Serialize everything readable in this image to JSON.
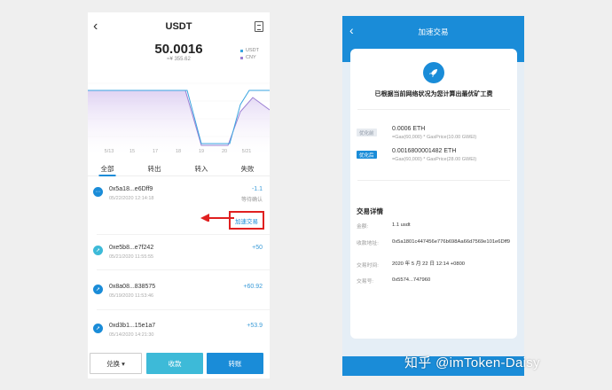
{
  "left": {
    "title": "USDT",
    "balance": "50.0016",
    "fiat": "≈¥ 355.62",
    "legend": [
      {
        "label": "USDT",
        "color": "#3aa5e0"
      },
      {
        "label": "CNY",
        "color": "#9b7fd3"
      }
    ],
    "x_ticks": [
      "5/13",
      "15",
      "17",
      "18",
      "19",
      "20",
      "5/21"
    ],
    "tabs": [
      "全部",
      "转出",
      "转入",
      "失败"
    ],
    "transactions": [
      {
        "addr": "0x5a18...e6Dff9",
        "date": "05/22/2020 12:14:18",
        "amount": "-1.1",
        "status": "等待确认",
        "icon": "more-icon"
      },
      {
        "addr": "0xe5b8...e7f242",
        "date": "05/21/2020 11:55:55",
        "amount": "+50",
        "status": "",
        "icon": "receive-icon"
      },
      {
        "addr": "0x8a08...838575",
        "date": "05/19/2020 11:53:46",
        "amount": "+60.92",
        "status": "",
        "icon": "receive-icon"
      },
      {
        "addr": "0xd3b1...15e1a7",
        "date": "05/14/2020 14:21:30",
        "amount": "+53.9",
        "status": "",
        "icon": "receive-icon"
      }
    ],
    "speed_up": "加速交易",
    "buttons": {
      "exchange": "兑换",
      "receive": "收款",
      "send": "转账"
    }
  },
  "right": {
    "title": "加速交易",
    "headline": "已根据当前网络状况为您计算出最优矿工费",
    "before_tag": "优化前",
    "before_value": "0.0006 ETH",
    "before_sub": "=Gas(60,000) * GasPrice(10.00 GWEI)",
    "after_tag": "优化后",
    "after_value": "0.0016800001482 ETH",
    "after_sub": "=Gas(60,000) * GasPrice(28.00 GWEI)",
    "details_title": "交易详情",
    "details": [
      {
        "k": "金额:",
        "v": "1.1 usdt"
      },
      {
        "k": "收款地址:",
        "v": "0x5a1801c447456e776b698Aa66d7569e101e6Dff9"
      },
      {
        "k": "交易时间:",
        "v": "2020 年 5 月 22 日 12:14 +0800"
      },
      {
        "k": "交易号:",
        "v": "0x5574...747960"
      }
    ]
  },
  "watermark": "知乎 @imToken-Daisy",
  "colors": {
    "accent": "#1a8cd8",
    "teal": "#3dbad8",
    "highlight": "#e02020"
  }
}
